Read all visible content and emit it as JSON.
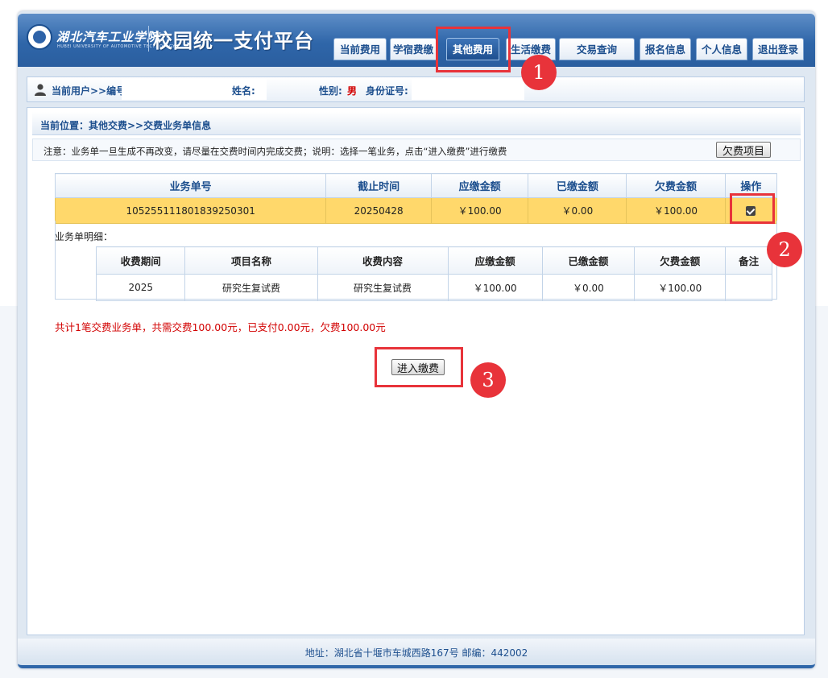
{
  "header": {
    "school_name": "湖北汽车工业学院",
    "school_sub": "HUBEI UNIVERSITY OF AUTOMOTIVE TECHNOLOGY",
    "platform_title": "校园统一支付平台",
    "nav": [
      {
        "label": "当前费用",
        "active": false
      },
      {
        "label": "学宿费缴",
        "active": false
      },
      {
        "label": "其他费用",
        "active": true
      },
      {
        "label": "生活缴费",
        "active": false
      },
      {
        "label": "交易查询",
        "active": false
      },
      {
        "label": "报名信息",
        "active": false
      },
      {
        "label": "个人信息",
        "active": false
      },
      {
        "label": "退出登录",
        "active": false
      }
    ]
  },
  "userbar": {
    "current_user": "当前用户>>编号",
    "name_label": "姓名:",
    "name_value": "",
    "gender_label": "性别:",
    "gender_value": "男",
    "id_label": "身份证号:"
  },
  "location": "当前位置：其他交费>>交费业务单信息",
  "notice": {
    "text": "注意：业务单一旦生成不再改变，请尽量在交费时间内完成交费；说明：选择一笔业务，点击“进入缴费”进行缴费",
    "owed_button": "欠费项目"
  },
  "main_table": {
    "headers": [
      "业务单号",
      "截止时间",
      "应缴金额",
      "已缴金额",
      "欠费金额",
      "操作"
    ],
    "row": [
      "105255111801839250301",
      "20250428",
      "￥100.00",
      "￥0.00",
      "￥100.00"
    ],
    "checked": true
  },
  "detail": {
    "label": "业务单明细：",
    "headers": [
      "收费期间",
      "项目名称",
      "收费内容",
      "应缴金额",
      "已缴金额",
      "欠费金额",
      "备注"
    ],
    "row": [
      "2025",
      "研究生复试费",
      "研究生复试费",
      "￥100.00",
      "￥0.00",
      "￥100.00",
      ""
    ]
  },
  "summary": "共计1笔交费业务单，共需交费100.00元，已支付0.00元，欠费100.00元",
  "pay_button": "进入缴费",
  "annotations": [
    "1",
    "2",
    "3"
  ],
  "footer": "地址：湖北省十堰市车城西路167号 邮编：442002",
  "colors": {
    "header_blue": "#2f66a9",
    "selected_row": "#ffd86b",
    "highlight_red": "#e8333a",
    "text_red": "#d20000"
  }
}
